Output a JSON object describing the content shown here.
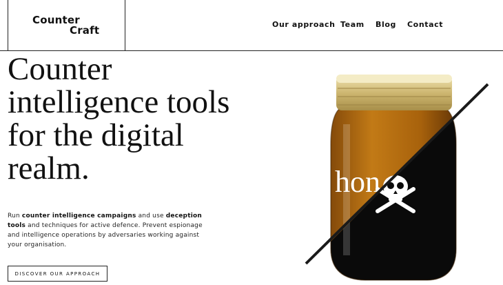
{
  "header": {
    "logo_line1": "Counter",
    "logo_line2": "Craft",
    "nav": [
      "Our approach",
      "Team",
      "Blog",
      "Contact"
    ]
  },
  "hero": {
    "title_lines": [
      "Counter",
      "intelligence tools",
      "for the digital",
      "realm."
    ],
    "text": {
      "p1": "Run ",
      "b1": "counter intelligence campaigns",
      "p2": " and use ",
      "b2": "deception tools",
      "p3": " and techniques for active defence. Prevent espionage and intelligence operations by adversaries working against your organisation."
    },
    "cta_label": "DISCOVER OUR APPROACH",
    "jar_label_text": "hon",
    "jar_icon": "skull-crossbones-icon"
  },
  "colors": {
    "background": "#ffffff",
    "text": "#111111",
    "honey": "#b06a0e",
    "lid": "#d9c98a",
    "poison": "#0a0a0a"
  }
}
